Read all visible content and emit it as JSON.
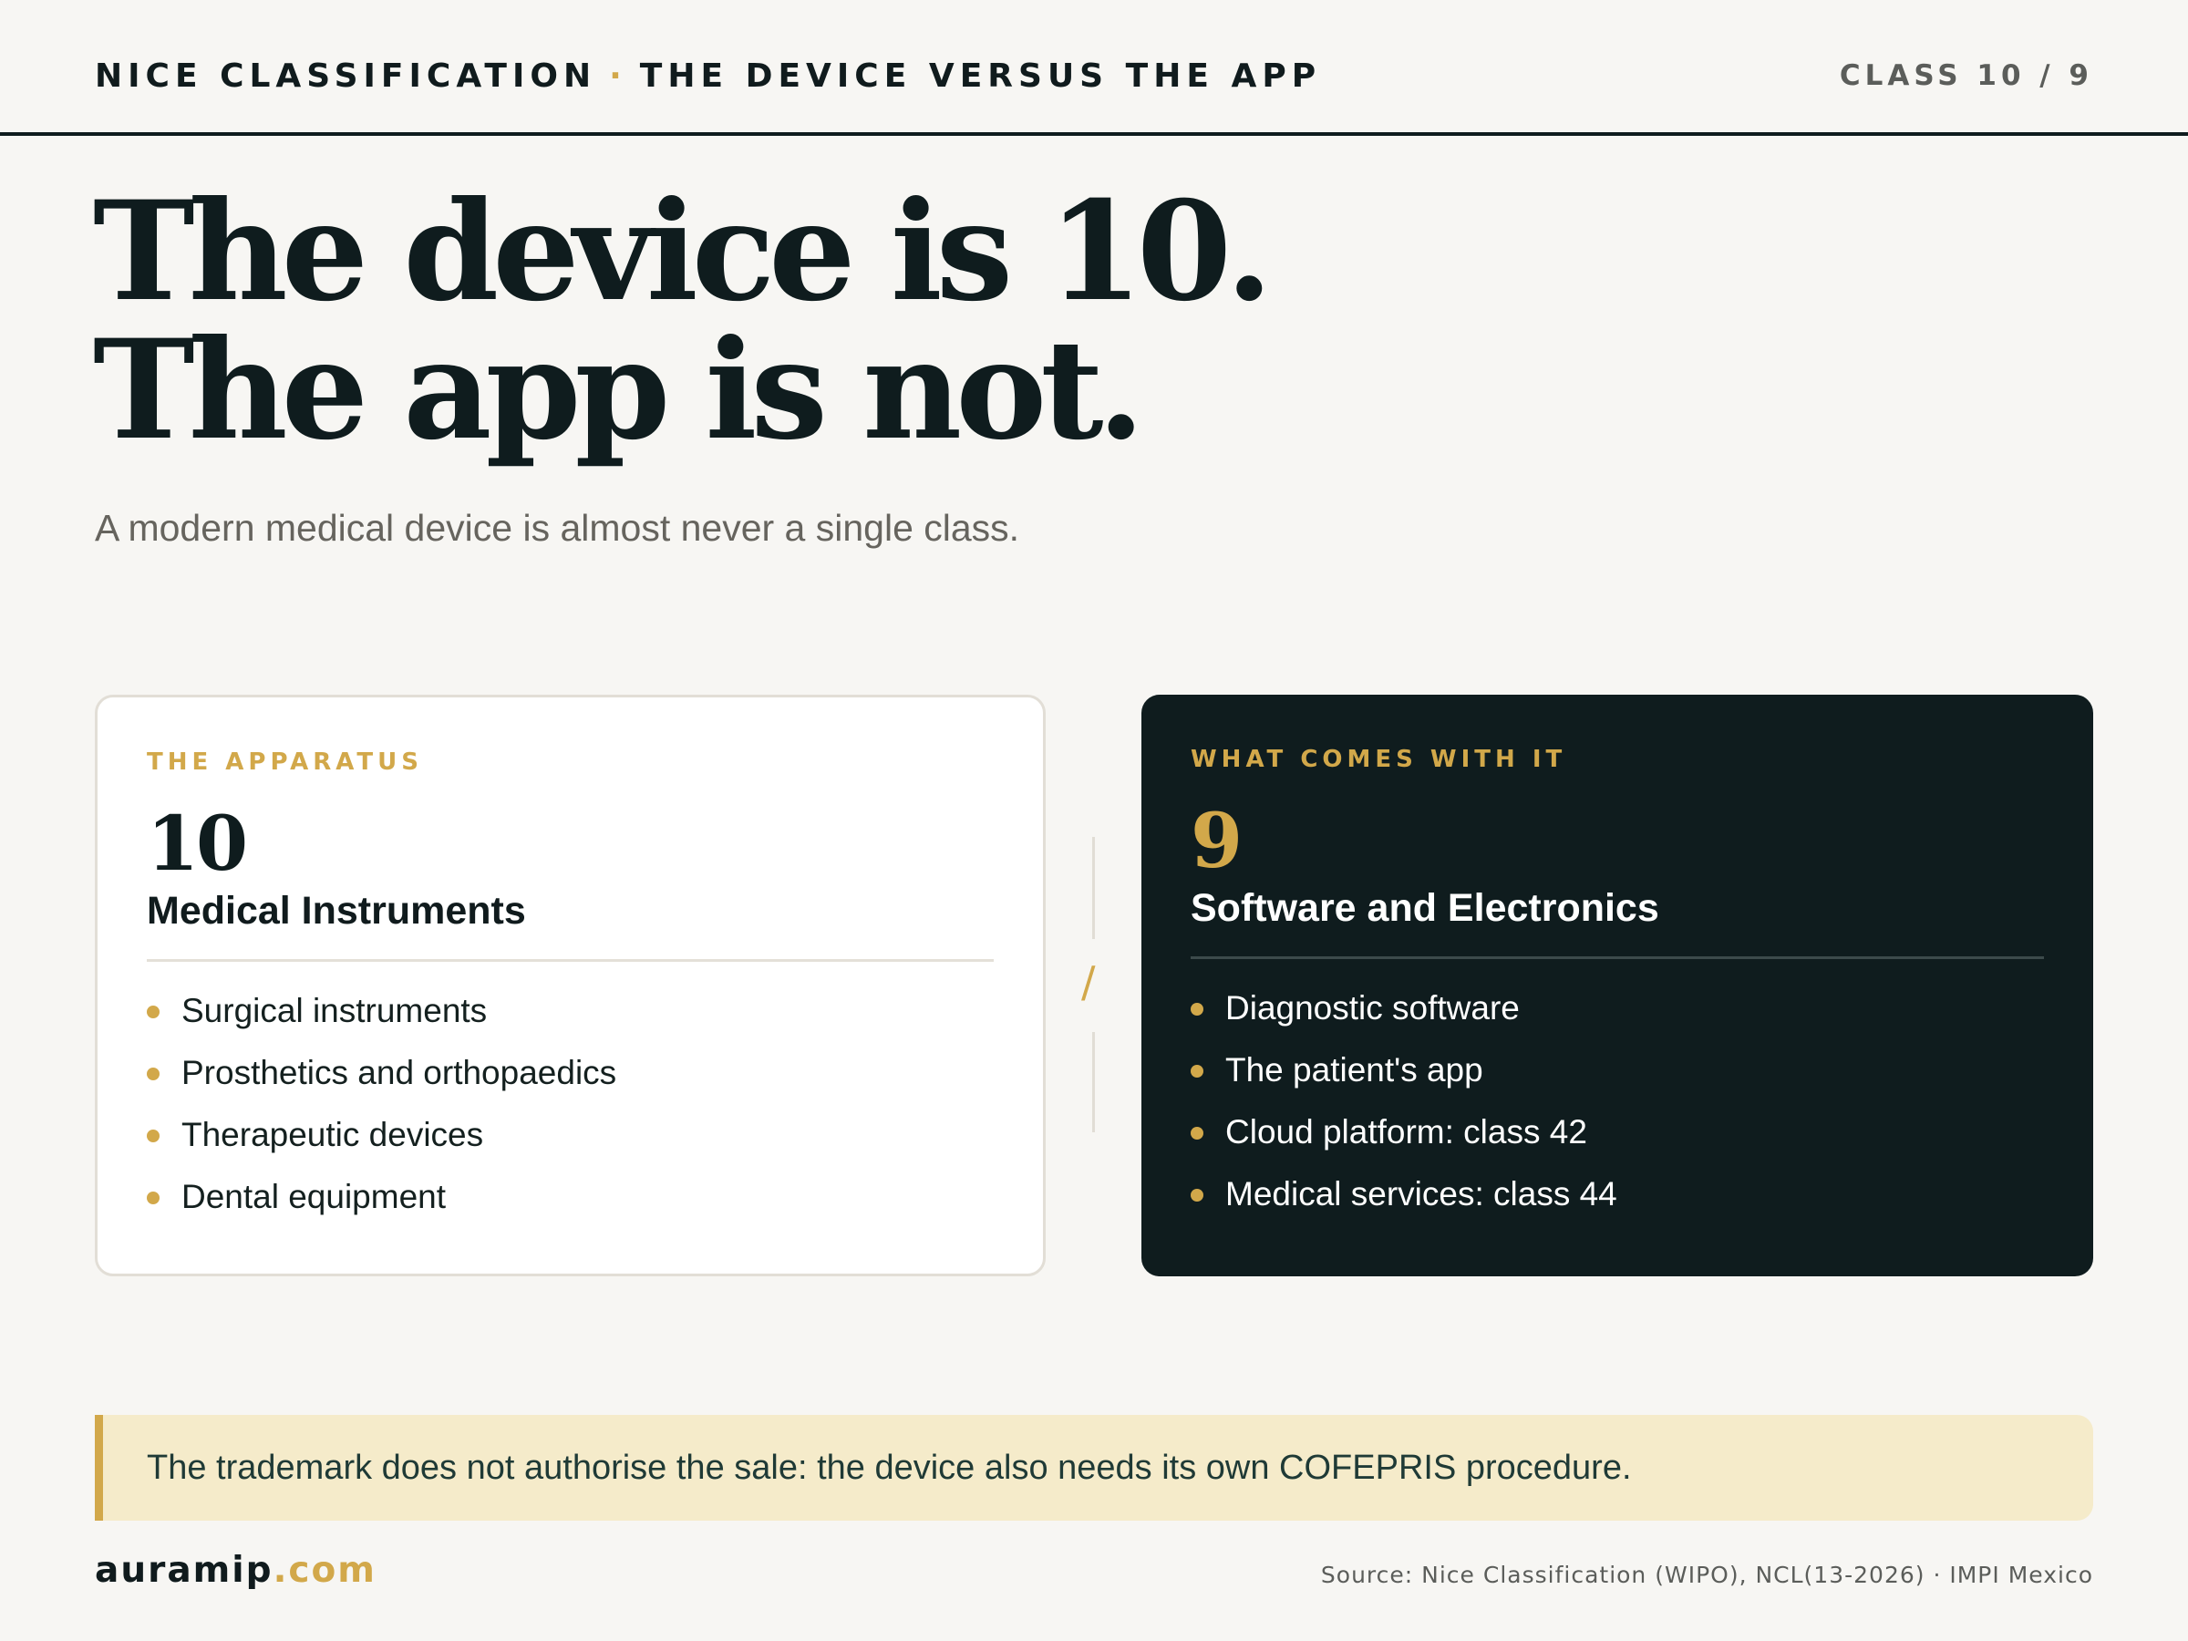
{
  "header": {
    "title": "NICE CLASSIFICATION",
    "separator": "·",
    "section": "THE DEVICE VERSUS THE APP",
    "page_label": "CLASS 10 / 9"
  },
  "hero": {
    "line1": "The device is 10.",
    "line2": "The app is not.",
    "subtitle": "A modern medical device is almost never a single class."
  },
  "cards": [
    {
      "eyebrow": "THE APPARATUS",
      "number": "10",
      "name": "Medical Instruments",
      "items": [
        "Surgical instruments",
        "Prosthetics and orthopaedics",
        "Therapeutic devices",
        "Dental equipment"
      ]
    },
    {
      "eyebrow": "WHAT COMES WITH IT",
      "number": "9",
      "name": "Software and Electronics",
      "items": [
        "Diagnostic software",
        "The patient's app",
        "Cloud platform: class 42",
        "Medical services: class 44"
      ]
    }
  ],
  "divider": {
    "glyph": "/"
  },
  "callout": {
    "text": "The trademark does not authorise the sale: the device also needs its own COFEPRIS procedure."
  },
  "footer": {
    "brand_main": "auramip",
    "brand_suffix": ".com",
    "source": "Source: Nice Classification (WIPO), NCL(13-2026) · IMPI Mexico"
  },
  "colors": {
    "accent": "#d2a84a",
    "ink": "#0f1c1e",
    "background": "#f7f6f3",
    "callout_bg": "#f5ebca"
  }
}
